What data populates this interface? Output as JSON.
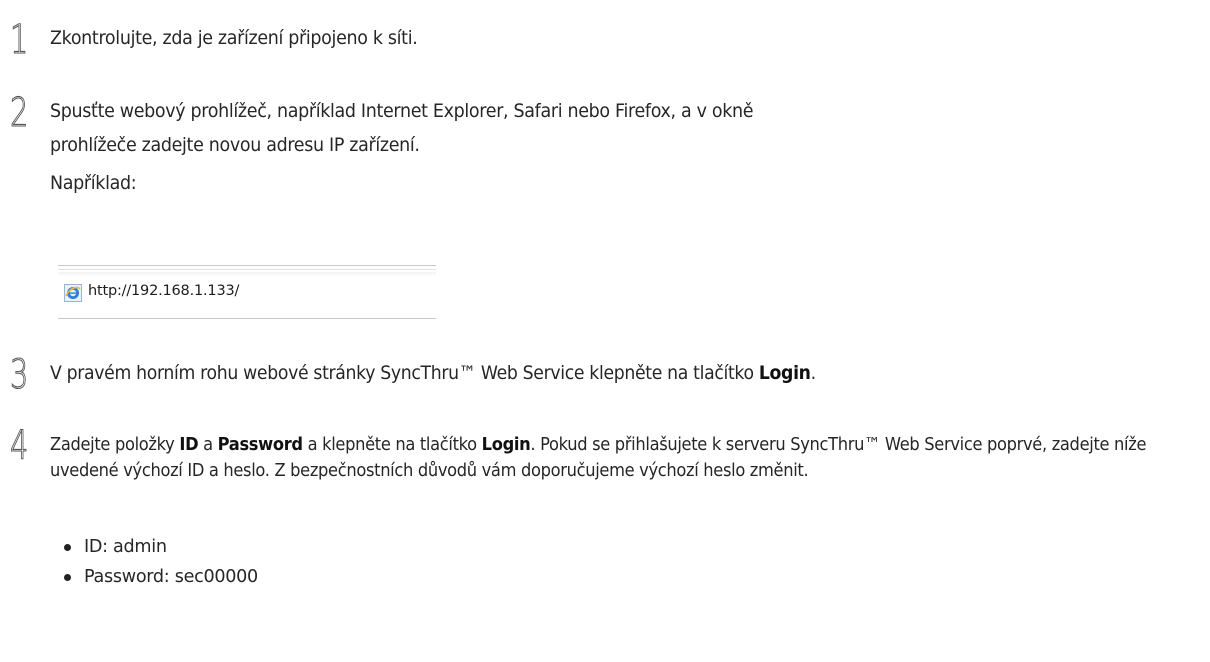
{
  "steps": [
    {
      "number": "1",
      "text": "Zkontrolujte, zda je zařízení připojeno k síti."
    },
    {
      "number": "2",
      "text_line1": "Spusťte webový prohlížeč, například Internet Explorer, Safari nebo Firefox, a v okně",
      "text_line2": "prohlížeče zadejte novou adresu IP zařízení.",
      "example_label": "Například:",
      "example_address": "http://192.168.1.133/",
      "example_icon": "internet-explorer-icon"
    },
    {
      "number": "3",
      "text_before": "V pravém horním rohu webové stránky SyncThru™ Web Service klepněte na tlačítko ",
      "text_bold": "Login",
      "text_after": "."
    },
    {
      "number": "4",
      "part1": "Zadejte položky ",
      "bold_id": "ID",
      "part2": " a ",
      "bold_password": "Password",
      "part3": " a klepněte na tlačítko ",
      "bold_login": "Login",
      "part4": ". Pokud se přihlašujete k serveru SyncThru™ Web Service poprvé, zadejte níže uvedené výchozí ID a heslo. Z bezpečnostních důvodů vám doporučujeme výchozí heslo změnit.",
      "bullets": [
        "ID: admin",
        "Password: sec00000"
      ]
    }
  ]
}
